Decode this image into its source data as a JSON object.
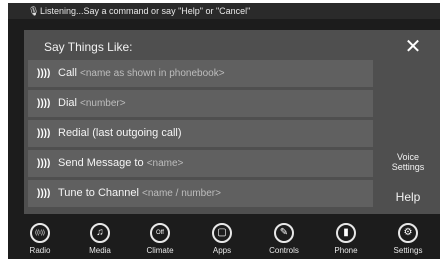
{
  "status": {
    "text": "Listening...Say a command or say \"Help\" or \"Cancel\"",
    "mic_icon": "mic-icon"
  },
  "panel": {
    "title": "Say Things Like:",
    "close_label": "✕"
  },
  "commands": [
    {
      "command": "Call",
      "hint": "<name as shown in phonebook>"
    },
    {
      "command": "Dial",
      "hint": "<number>"
    },
    {
      "command": "Redial (last outgoing call)",
      "hint": ""
    },
    {
      "command": "Send Message to",
      "hint": "<name>"
    },
    {
      "command": "Tune to Channel",
      "hint": "<name / number>"
    }
  ],
  "side": {
    "voice_settings_line1": "Voice",
    "voice_settings_line2": "Settings",
    "help": "Help"
  },
  "nav": [
    {
      "label": "Radio",
      "icon": "radio-icon",
      "glyph": "((ı))"
    },
    {
      "label": "Media",
      "icon": "music-note-icon",
      "glyph": "♫"
    },
    {
      "label": "Climate",
      "icon": "climate-off-icon",
      "glyph": "Off"
    },
    {
      "label": "Apps",
      "icon": "apps-icon",
      "glyph": "▢"
    },
    {
      "label": "Controls",
      "icon": "wrench-icon",
      "glyph": "✎"
    },
    {
      "label": "Phone",
      "icon": "phone-signal-icon",
      "glyph": "▮"
    },
    {
      "label": "Settings",
      "icon": "gear-icon",
      "glyph": "⚙"
    }
  ],
  "colors": {
    "background": "#1c1c1c",
    "panel": "#4f4f4f",
    "row": "#606060",
    "text": "#f5f5f5",
    "hint": "#bdbdbd"
  }
}
